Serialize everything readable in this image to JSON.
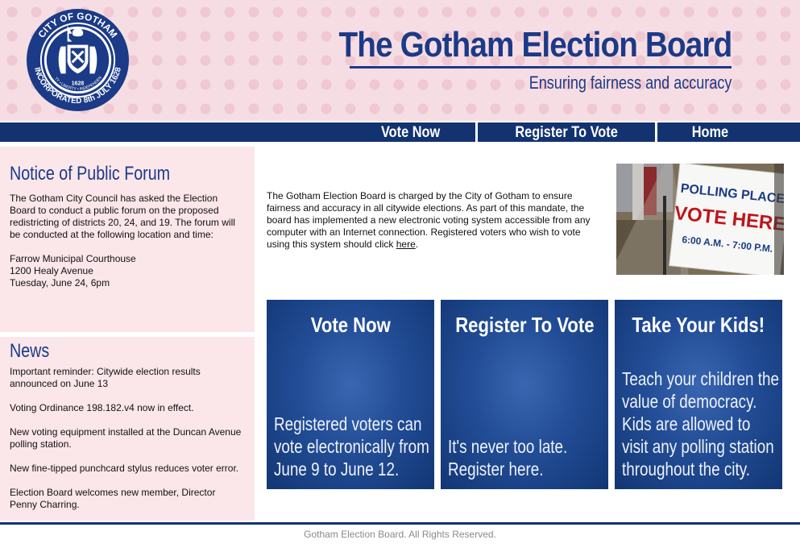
{
  "header": {
    "seal": {
      "top_text": "CITY OF GOTHAM",
      "bottom_text": "INCORPORATED 8th JULY 1628",
      "motto": "UNITY • LIBERTY • INDEPENDENCE",
      "year": "1628"
    },
    "title": "The Gotham Election Board",
    "tagline": "Ensuring fairness and accuracy"
  },
  "nav": {
    "vote_now": "Vote Now",
    "register": "Register To Vote",
    "home": "Home"
  },
  "forum": {
    "title": "Notice of Public Forum",
    "body": "The Gotham City Council has asked the Election Board to conduct a public forum on the proposed redistricting of districts 20, 24, and 19. The forum will be conducted at the following location and time:",
    "location": "Farrow Municipal Courthouse",
    "address": "1200 Healy Avenue",
    "time": "Tuesday, June 24, 6pm"
  },
  "news": {
    "title": "News",
    "items": [
      "Important reminder: Citywide election results announced on June 13",
      "Voting Ordinance 198.182.v4 now in effect.",
      "New voting equipment installed at the Duncan Avenue polling station.",
      "New fine-tipped punchcard stylus reduces voter error.",
      "Election Board welcomes new member, Director Penny Charring."
    ]
  },
  "intro": {
    "text": "The Gotham Election Board is charged by the City of Gotham to ensure fairness and accuracy in all citywide elections. As part of this mandate, the board has implemented a new electronic voting system accessible from any computer with an Internet connection. Registered voters who wish to vote using this system should click",
    "link": "here",
    "end": "."
  },
  "photo": {
    "sign_line1": "POLLING PLACE",
    "sign_line2": "VOTE HERE",
    "sign_line3": "6:00 A.M. - 7:00 P.M."
  },
  "promos": [
    {
      "title": "Vote Now",
      "body": "Registered voters can vote electronically from June 9 to June 12."
    },
    {
      "title": "Register To Vote",
      "body": "It's never too late. Register here."
    },
    {
      "title": "Take Your Kids!",
      "body": "Teach your children the value of democracy. Kids are allowed to visit any polling station throughout the city."
    }
  ],
  "footer": {
    "text": "Gotham Election Board. All Rights Reserved."
  },
  "colors": {
    "brand_blue": "#1b3a87",
    "nav_blue": "#12336f",
    "header_pink": "#f6dde3",
    "sidebar_pink": "#fbe6ea"
  }
}
